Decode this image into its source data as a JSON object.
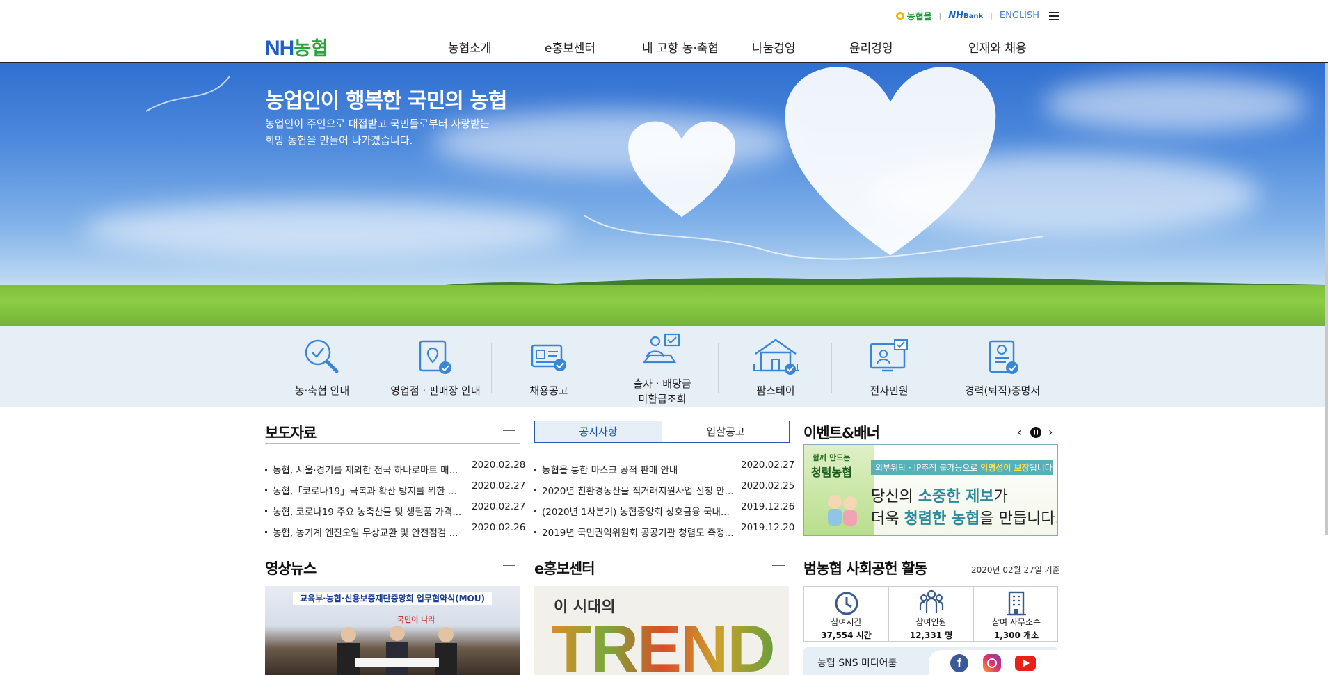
{
  "util": {
    "mall_label": "농협몰",
    "bank_label": "NH",
    "bank_suffix": "Bank",
    "english_label": "ENGLISH"
  },
  "logo": {
    "en": "NH",
    "ko": "농협"
  },
  "nav": [
    {
      "label": "농협소개"
    },
    {
      "label": "e홍보센터"
    },
    {
      "label": "내 고향 농·축협"
    },
    {
      "label": "나눔경영"
    },
    {
      "label": "윤리경영"
    },
    {
      "label": "인재와 채용"
    }
  ],
  "hero": {
    "title": "농업인이 행복한 국민의 농협",
    "line1": "농업인이 주인으로 대접받고 국민들로부터 사랑받는",
    "line2": "희망 농협을 만들어 나가겠습니다."
  },
  "quick": [
    {
      "line1": "농·축협 안내",
      "line2": ""
    },
    {
      "line1": "영업점 · 판매장 안내",
      "line2": ""
    },
    {
      "line1": "채용공고",
      "line2": ""
    },
    {
      "line1": "출자 · 배당금",
      "line2": "미환급조회"
    },
    {
      "line1": "팜스테이",
      "line2": ""
    },
    {
      "line1": "전자민원",
      "line2": ""
    },
    {
      "line1": "경력(퇴직)증명서",
      "line2": ""
    }
  ],
  "press": {
    "title": "보도자료",
    "items": [
      {
        "text": "농협, 서울·경기를 제외한 전국 하나로마트 매...",
        "date": "2020.02.28"
      },
      {
        "text": "농협,「코로나19」극복과 확산 방지를 위한 ...",
        "date": "2020.02.27"
      },
      {
        "text": "농협, 코로나19 주요 농축산물 및 생필품 가격...",
        "date": "2020.02.27"
      },
      {
        "text": "농협, 농기계 엔진오일 무상교환 및 안전점검 ...",
        "date": "2020.02.26"
      }
    ]
  },
  "notice": {
    "tab_active": "공지사항",
    "tab_inactive": "입찰공고",
    "items": [
      {
        "text": "농협을 통한 마스크 공적 판매 안내",
        "date": "2020.02.27"
      },
      {
        "text": "2020년 친환경농산물 직거래지원사업 신청 안...",
        "date": "2020.02.25"
      },
      {
        "text": "(2020년 1사분기) 농협중앙회 상호금융 국내...",
        "date": "2019.12.26"
      },
      {
        "text": "2019년 국민권익위원회 공공기관 청렴도 측정...",
        "date": "2019.12.20"
      }
    ]
  },
  "events": {
    "title": "이벤트&배너",
    "banner_tag1": "함께 만드는",
    "banner_tag2": "청렴농협",
    "banner_top_pre": "외부위탁 · IP추적 불가능으로 ",
    "banner_top_hl": "익명성이 보장",
    "banner_top_post": "됩니다.",
    "banner_l1_pre": "당신의 ",
    "banner_l1_hl": "소중한 제보",
    "banner_l1_post": "가",
    "banner_l2_pre": "더욱 ",
    "banner_l2_hl": "청렴한 농협",
    "banner_l2_post": "을 만듭니다."
  },
  "video_news": {
    "title": "영상뉴스",
    "banner_line1": "교육부·농협·신용보증재단중앙회 업무협약식(MOU)",
    "banner_line2": "국민이 나라"
  },
  "ecenter": {
    "title": "e홍보센터",
    "img_small": "이 시대의",
    "img_big": "TREND"
  },
  "csr": {
    "title": "범농협 사회공헌 활동",
    "asof": "2020년 02월 27일 기준",
    "stats": [
      {
        "label": "참여시간",
        "value": "37,554 시간"
      },
      {
        "label": "참여인원",
        "value": "12,331 명"
      },
      {
        "label": "참여 사무소수",
        "value": "1,300 개소"
      }
    ],
    "sns_label": "농협 SNS 미디어룸"
  },
  "colors": {
    "brand_blue": "#1f5fbf",
    "brand_green": "#2aa33b",
    "icon_blue": "#3a86d6"
  }
}
